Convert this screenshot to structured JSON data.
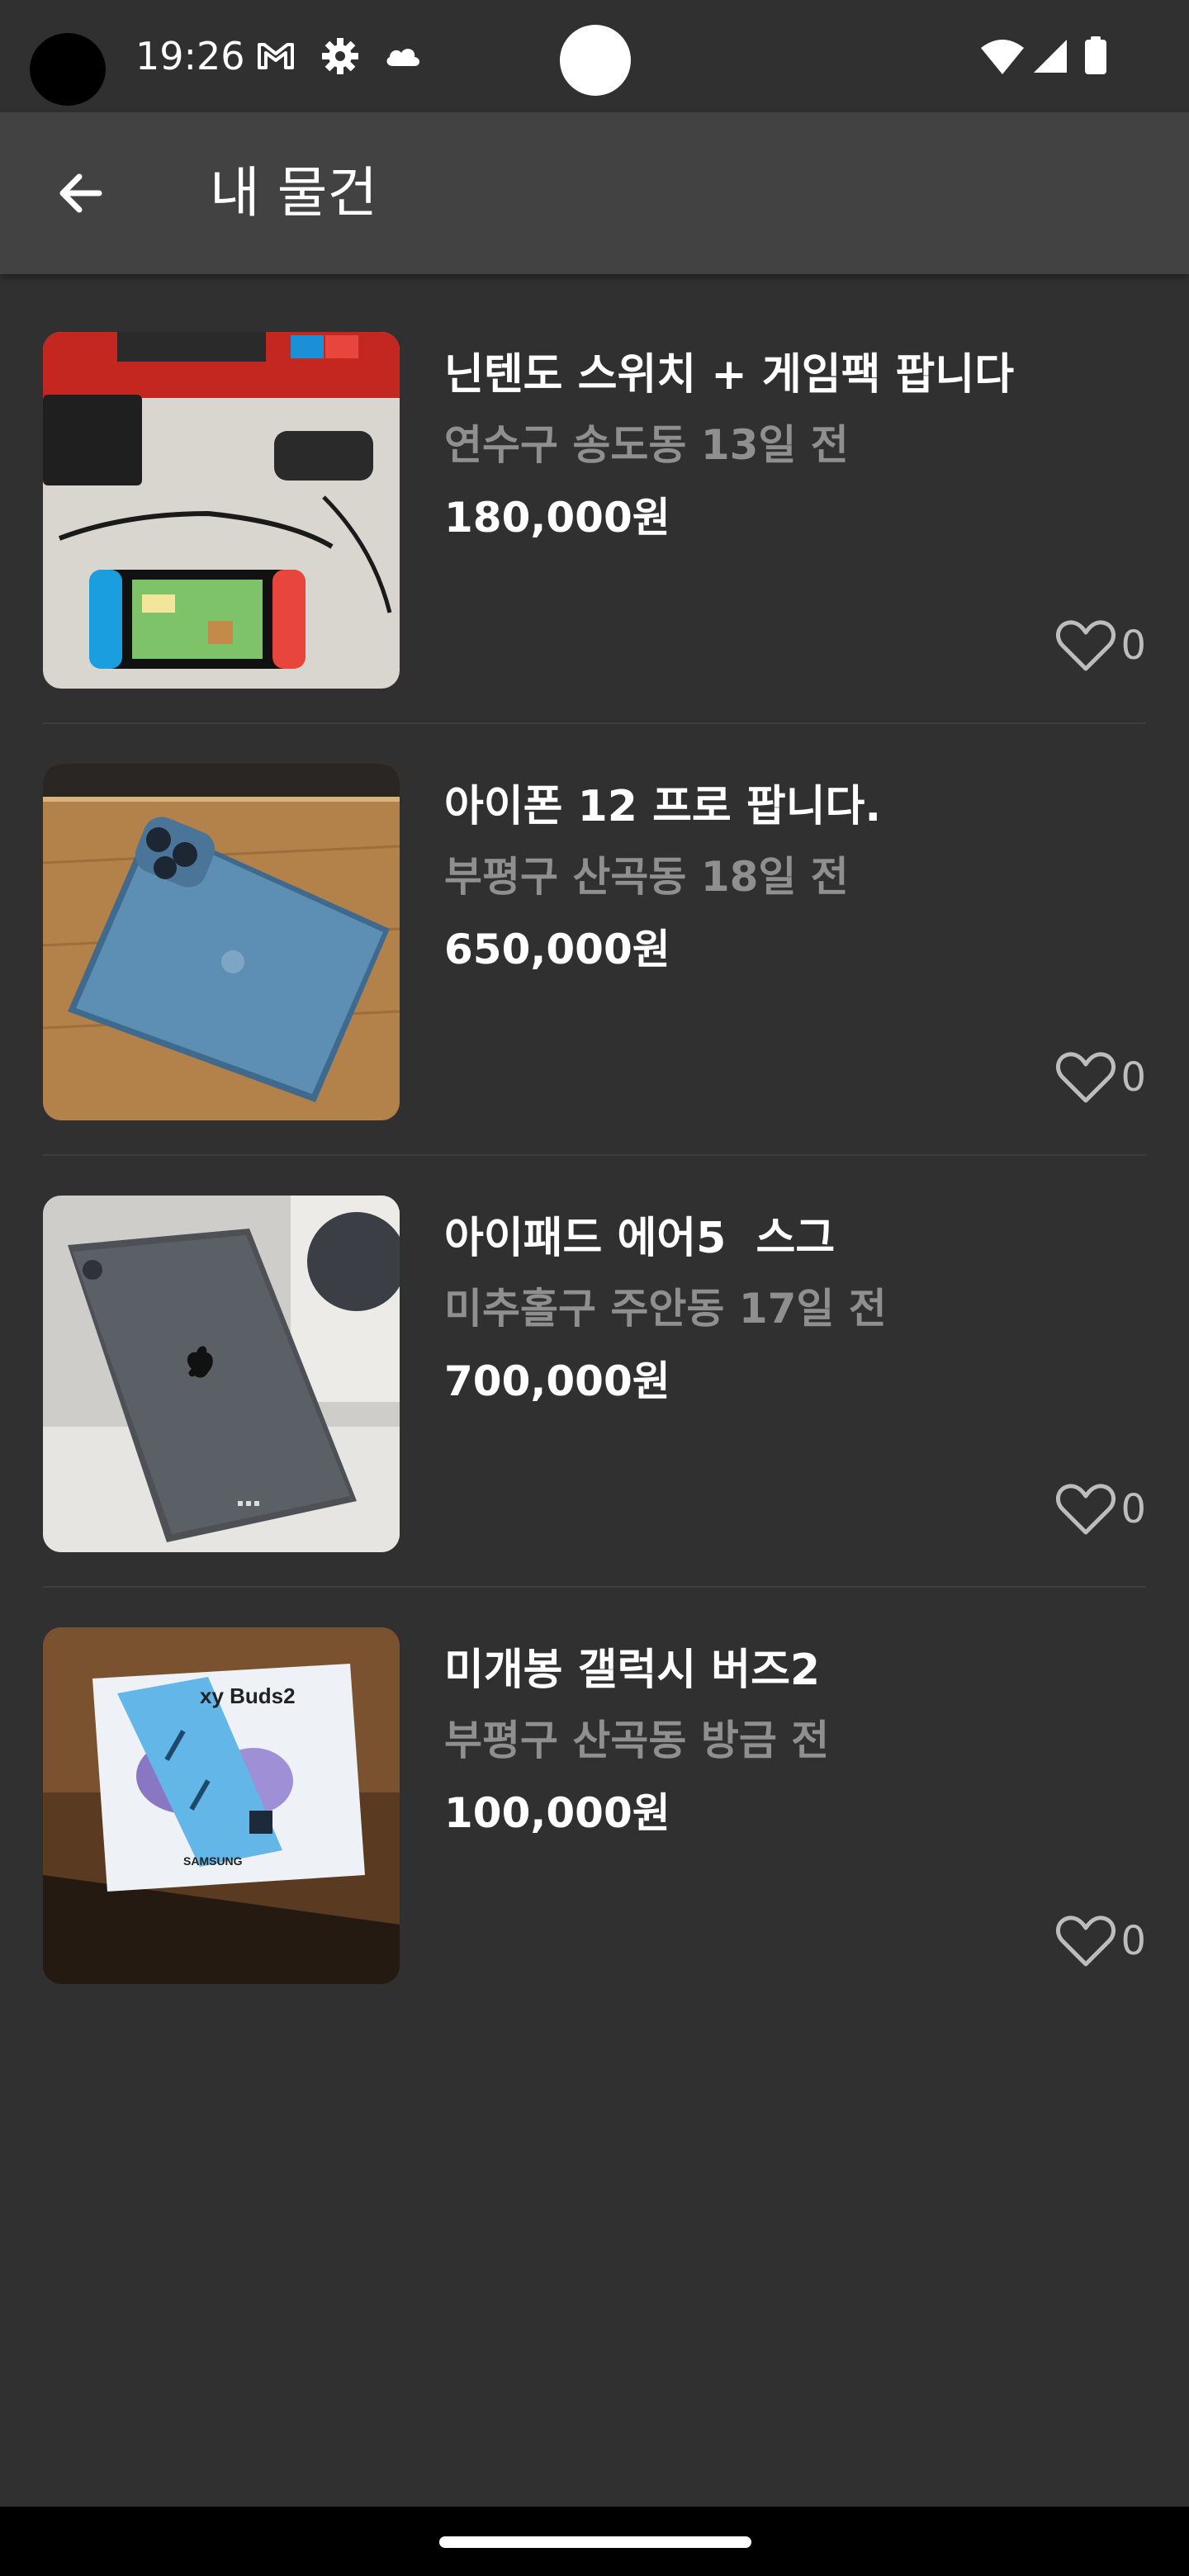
{
  "status_bar": {
    "time": "19:26",
    "icons": [
      "gmail-icon",
      "settings-gear-icon",
      "cloud-icon",
      "wifi-icon",
      "cell-signal-icon",
      "battery-icon"
    ]
  },
  "app_bar": {
    "title": "내 물건",
    "back_icon": "arrow-back-icon"
  },
  "items": [
    {
      "title": "닌텐도 스위치 + 게임팩 팝니다",
      "meta": "연수구 송도동 13일 전",
      "price": "180,000원",
      "likes": "0",
      "image": "nintendo-switch-photo"
    },
    {
      "title": "아이폰 12 프로 팝니다.",
      "meta": "부평구 산곡동 18일 전",
      "price": "650,000원",
      "likes": "0",
      "image": "iphone-12-pro-photo"
    },
    {
      "title": "아이패드 에어5  스그",
      "meta": "미추홀구 주안동 17일 전",
      "price": "700,000원",
      "likes": "0",
      "image": "ipad-air5-photo"
    },
    {
      "title": "미개봉 갤럭시 버즈2",
      "meta": "부평구 산곡동 방금 전",
      "price": "100,000원",
      "likes": "0",
      "image": "galaxy-buds2-box-photo",
      "image_text": {
        "product": "xy Buds2",
        "brand": "SAMSUNG"
      }
    }
  ],
  "colors": {
    "background": "#303030",
    "app_bar": "#424242",
    "meta_text": "#8f8f8f",
    "like_text": "#bdbdbd"
  }
}
